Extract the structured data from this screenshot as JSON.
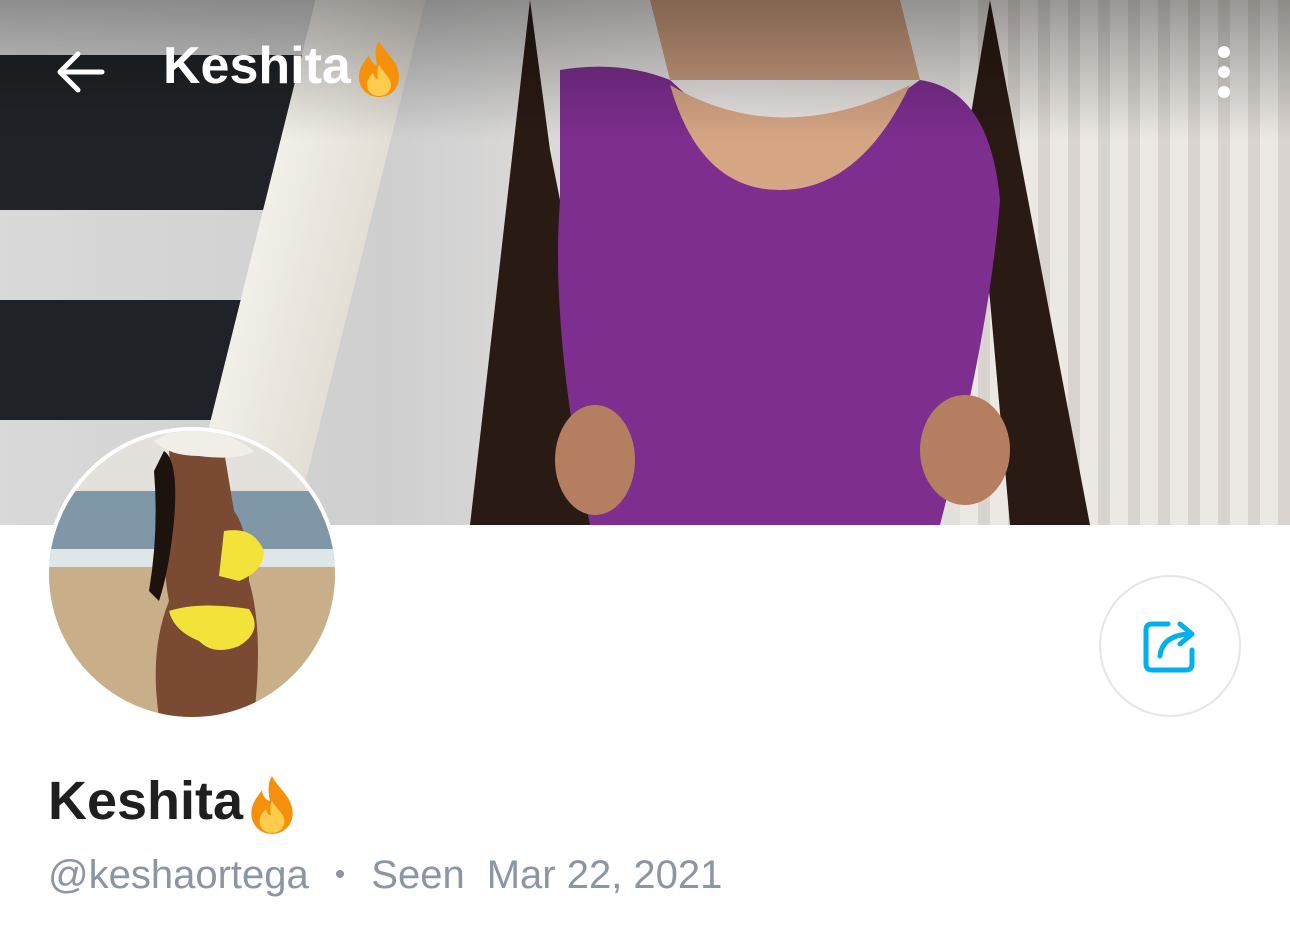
{
  "topbar": {
    "title": "Keshita",
    "title_emoji": "fire-icon"
  },
  "profile": {
    "name": "Keshita",
    "name_emoji": "fire-icon",
    "handle": "@keshaortega",
    "separator": "•",
    "seen_label": "Seen",
    "seen_date": "Mar 22, 2021"
  },
  "icons": {
    "back": "arrow-left-icon",
    "more": "more-vertical-icon",
    "share": "share-icon"
  },
  "colors": {
    "accent": "#00aff0",
    "meta_text": "#8a96a3",
    "name_text": "#1f1f1f",
    "cover_top": "#7d2e8f"
  }
}
